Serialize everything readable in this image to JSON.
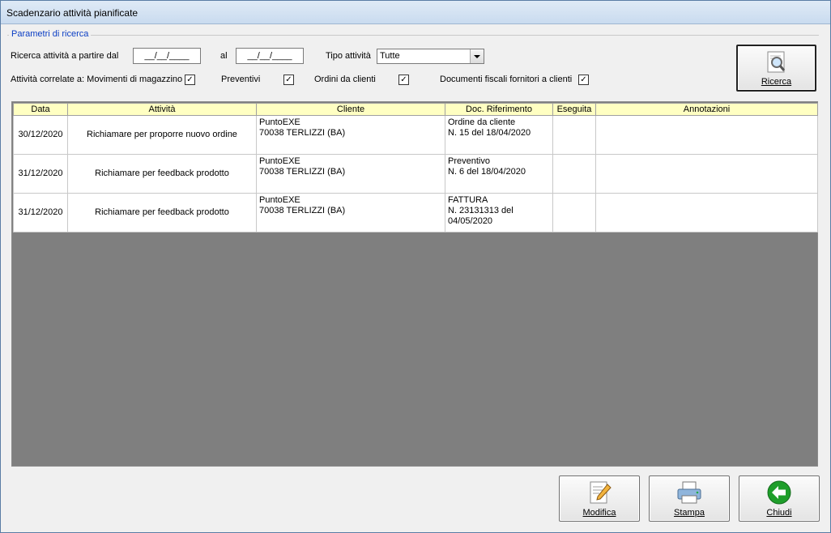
{
  "window": {
    "title": "Scadenzario attività pianificate"
  },
  "search": {
    "legend": "Parametri di ricerca",
    "from_label": "Ricerca attività a partire dal",
    "from_value": "__/__/____",
    "to_label": "al",
    "to_value": "__/__/____",
    "type_label": "Tipo attività",
    "type_value": "Tutte",
    "related_label": "Attività correlate a: Movimenti di magazzino",
    "preventivi_label": "Preventivi",
    "ordini_label": "Ordini da clienti",
    "documenti_label": "Documenti fiscali fornitori a clienti",
    "check_mark": "✓",
    "search_button": "Ricerca"
  },
  "table": {
    "columns": [
      "Data",
      "Attività",
      "Cliente",
      "Doc. Riferimento",
      "Eseguita",
      "Annotazioni"
    ],
    "rows": [
      {
        "data": "30/12/2020",
        "attivita": "Richiamare per proporre nuovo ordine",
        "cliente_1": "PuntoEXE",
        "cliente_2": "70038 TERLIZZI (BA)",
        "doc_1": "Ordine da cliente",
        "doc_2": "N. 15 del 18/04/2020",
        "eseguita": "",
        "annotazioni": ""
      },
      {
        "data": "31/12/2020",
        "attivita": "Richiamare per feedback prodotto",
        "cliente_1": "PuntoEXE",
        "cliente_2": "70038 TERLIZZI (BA)",
        "doc_1": "Preventivo",
        "doc_2": "N. 6 del 18/04/2020",
        "eseguita": "",
        "annotazioni": ""
      },
      {
        "data": "31/12/2020",
        "attivita": "Richiamare per feedback prodotto",
        "cliente_1": "PuntoEXE",
        "cliente_2": "70038 TERLIZZI (BA)",
        "doc_1": "FATTURA",
        "doc_2": "N. 23131313 del 04/05/2020",
        "eseguita": "",
        "annotazioni": ""
      }
    ]
  },
  "buttons": {
    "modifica": "Modifica",
    "stampa": "Stampa",
    "chiudi": "Chiudi"
  },
  "colors": {
    "header_bg": "#ffffc2",
    "legend": "#0b3ec4",
    "grid_empty": "#7f7f7f",
    "close_icon": "#1e9e2a"
  }
}
